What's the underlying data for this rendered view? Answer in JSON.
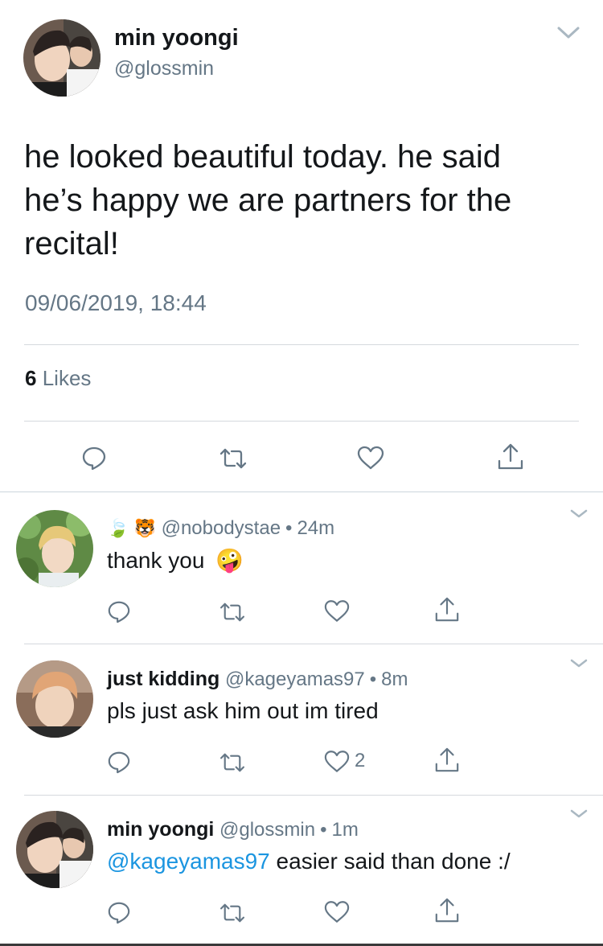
{
  "main_tweet": {
    "name": "min yoongi",
    "handle": "@glossmin",
    "text": "he looked beautiful today. he said he’s happy we are partners for the recital!",
    "timestamp": "09/06/2019, 18:44",
    "likes_count": "6",
    "likes_label": "Likes"
  },
  "replies": [
    {
      "name_emojis": "🍃 🐯",
      "handle": "@nobodystae",
      "time": "24m",
      "text": "thank you",
      "emoji": "🤪",
      "like_count": ""
    },
    {
      "name": "just kidding",
      "handle": "@kageyamas97",
      "time": "8m",
      "text": "pls just ask him out im tired",
      "like_count": "2"
    },
    {
      "name": "min yoongi",
      "handle": "@glossmin",
      "time": "1m",
      "mention": "@kageyamas97",
      "text": " easier said than done :/",
      "like_count": ""
    }
  ],
  "separator_dot": "•",
  "colors": {
    "text": "#14171a",
    "secondary": "#657786",
    "link": "#1b95e0",
    "divider": "#d5d9dd"
  },
  "icons": [
    "chevron-down-icon",
    "reply-icon",
    "retweet-icon",
    "like-icon",
    "share-icon"
  ]
}
